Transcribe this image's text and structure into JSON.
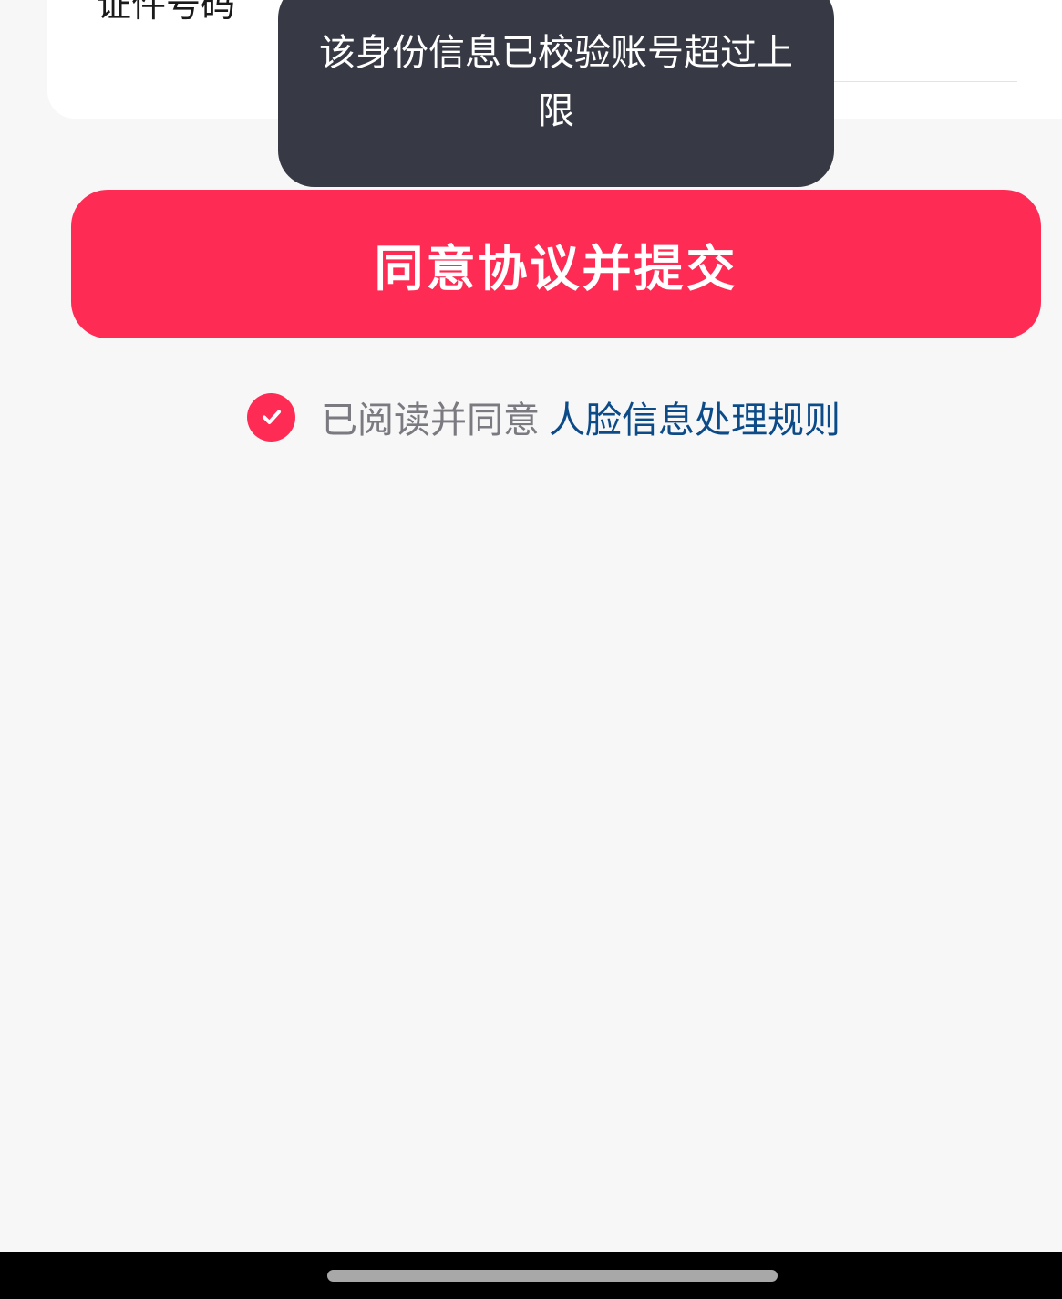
{
  "form": {
    "id_number_label": "证件号码"
  },
  "toast": {
    "message": "该身份信息已校验账号超过上限"
  },
  "submit": {
    "label": "同意协议并提交"
  },
  "agreement": {
    "checked": true,
    "prefix": "已阅读并同意",
    "link_text": "人脸信息处理规则",
    "icon": "check-circle-icon"
  },
  "colors": {
    "accent": "#fe2c55",
    "toast_bg": "#373a44",
    "link": "#0c4b88",
    "page_bg": "#f7f7f8"
  }
}
